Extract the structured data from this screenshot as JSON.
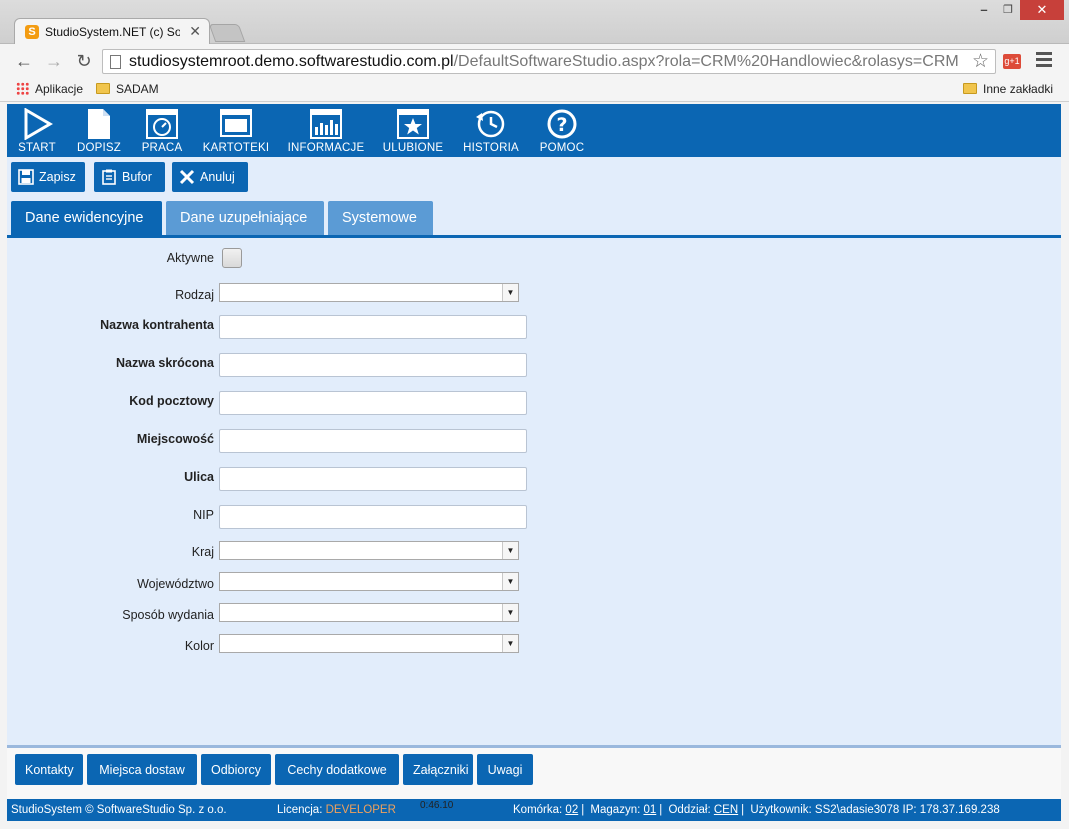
{
  "browser": {
    "tab_title": "StudioSystem.NET (c) Soft",
    "tab_favicon": "S",
    "url_host": "studiosystemroot.demo.softwarestudio.com.pl",
    "url_rest": "/DefaultSoftwareStudio.aspx?rola=CRM%20Handlowiec&rolasys=CRM",
    "gplus": "g+1",
    "bookmarks": [
      {
        "label": "Aplikacje"
      },
      {
        "label": "SADAM"
      },
      {
        "label": "Inne zakładki"
      }
    ]
  },
  "nav": {
    "items": [
      {
        "label": "START",
        "icon": "play-icon"
      },
      {
        "label": "DOPISZ",
        "icon": "document-icon"
      },
      {
        "label": "PRACA",
        "icon": "gauge-icon"
      },
      {
        "label": "KARTOTEKI",
        "icon": "monitor-icon"
      },
      {
        "label": "INFORMACJE",
        "icon": "chart-icon"
      },
      {
        "label": "ULUBIONE",
        "icon": "star-icon"
      },
      {
        "label": "HISTORIA",
        "icon": "history-icon"
      },
      {
        "label": "POMOC",
        "icon": "help-icon"
      }
    ]
  },
  "actions": {
    "save": "Zapisz",
    "buffer": "Bufor",
    "cancel": "Anuluj"
  },
  "tabs": [
    {
      "label": "Dane ewidencyjne",
      "active": true
    },
    {
      "label": "Dane uzupełniające",
      "active": false
    },
    {
      "label": "Systemowe",
      "active": false
    }
  ],
  "form": {
    "active_label": "Aktywne",
    "active_checked": false,
    "rodzaj": {
      "label": "Rodzaj",
      "value": ""
    },
    "nazwa_kontrahenta": {
      "label": "Nazwa kontrahenta",
      "value": ""
    },
    "nazwa_skrocona": {
      "label": "Nazwa skrócona",
      "value": ""
    },
    "kod_pocztowy": {
      "label": "Kod pocztowy",
      "value": ""
    },
    "miejscowosc": {
      "label": "Miejscowość",
      "value": ""
    },
    "ulica": {
      "label": "Ulica",
      "value": ""
    },
    "nip": {
      "label": "NIP",
      "value": ""
    },
    "kraj": {
      "label": "Kraj",
      "value": ""
    },
    "wojewodztwo": {
      "label": "Województwo",
      "value": ""
    },
    "sposob_wydania": {
      "label": "Sposób wydania",
      "value": ""
    },
    "kolor": {
      "label": "Kolor",
      "value": ""
    }
  },
  "bottom_buttons": [
    "Kontakty",
    "Miejsca dostaw",
    "Odbiorcy",
    "Cechy dodatkowe",
    "Załączniki",
    "Uwagi"
  ],
  "status": {
    "company": "StudioSystem © SoftwareStudio Sp. z o.o.",
    "license_label": "Licencja:",
    "license_value": "DEVELOPER",
    "timer": "0:46.10",
    "komorka_label": "Komórka:",
    "komorka_value": "02",
    "magazyn_label": "Magazyn:",
    "magazyn_value": "01",
    "oddzial_label": "Oddział:",
    "oddzial_value": "CEN",
    "user_label": "Użytkownik:",
    "user_value": "SS2\\adasie3078",
    "ip_label": "IP:",
    "ip_value": "178.37.169.238"
  },
  "colors": {
    "primary": "#0b66b3",
    "tab_inactive": "#5b9bd5",
    "content_bg": "#e2edfb",
    "license": "#f0a15c"
  }
}
